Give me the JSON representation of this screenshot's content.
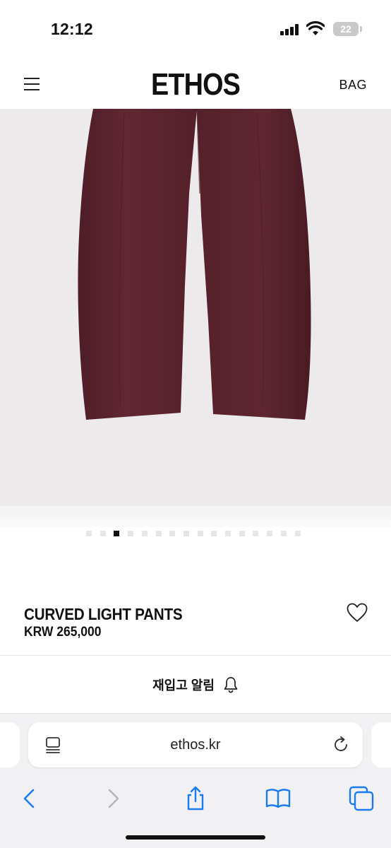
{
  "status_bar": {
    "time": "12:12",
    "battery": "22"
  },
  "header": {
    "logo": "ETHOS",
    "bag_label": "BAG"
  },
  "gallery": {
    "dot_count": 16,
    "active_index": 2
  },
  "product": {
    "name": "CURVED LIGHT PANTS",
    "price": "KRW 265,000"
  },
  "restock": {
    "label": "재입고 알림"
  },
  "browser": {
    "url": "ethos.kr"
  },
  "colors": {
    "pants": "#5c2431",
    "image_bg": "#eceaea",
    "accent": "#1a7cf2"
  }
}
